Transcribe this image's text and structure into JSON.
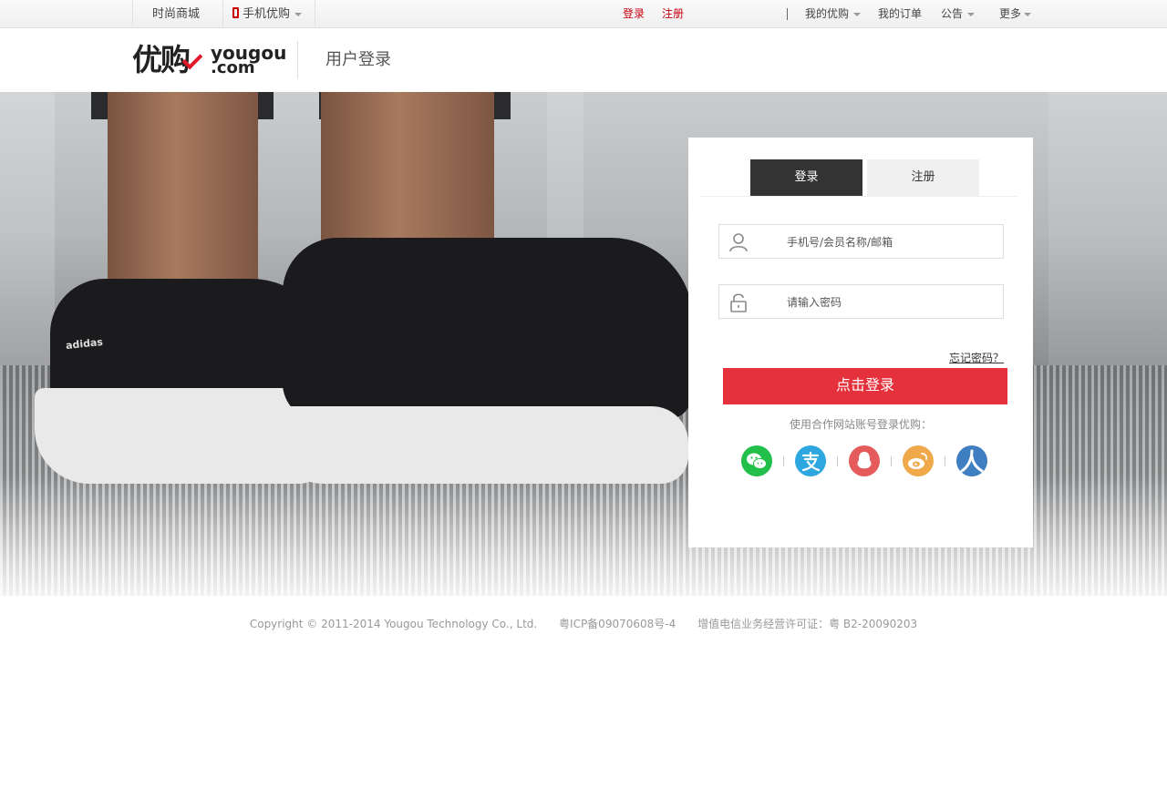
{
  "topbar": {
    "site_name": "时尚商城",
    "mobile": "手机优购",
    "login": "登录",
    "register": "注册",
    "my_yougou": "我的优购",
    "my_orders": "我的订单",
    "notice": "公告",
    "more": "更多"
  },
  "header": {
    "logo_cn": "优购",
    "logo_en_line1": "yougou",
    "logo_en_line2": ".com",
    "page_title": "用户登录"
  },
  "banner": {
    "brand_on_shoe": "adidas"
  },
  "login_panel": {
    "tab_login": "登录",
    "tab_register": "注册",
    "username_placeholder": "手机号/会员名称/邮箱",
    "password_placeholder": "请输入密码",
    "forgot_password": "忘记密码？",
    "submit": "点击登录",
    "partner_tip": "使用合作网站账号登录优购：",
    "partners": [
      {
        "icon": "wechat-icon",
        "color": "#22c04a"
      },
      {
        "icon": "alipay-icon",
        "color": "#2ea7e0"
      },
      {
        "icon": "qq-icon",
        "color": "#e55b5b"
      },
      {
        "icon": "weibo-icon",
        "color": "#f0a94a"
      },
      {
        "icon": "renren-icon",
        "color": "#3f7fc1"
      }
    ]
  },
  "footer": {
    "copyright": "Copyright © 2011-2014 Yougou Technology Co., Ltd.",
    "icp": "粤ICP备09070608号-4",
    "license": "增值电信业务经营许可证：粤 B2-20090203"
  },
  "colors": {
    "accent_red": "#e4313c",
    "link_red": "#c8000f",
    "tab_dark": "#333333"
  }
}
